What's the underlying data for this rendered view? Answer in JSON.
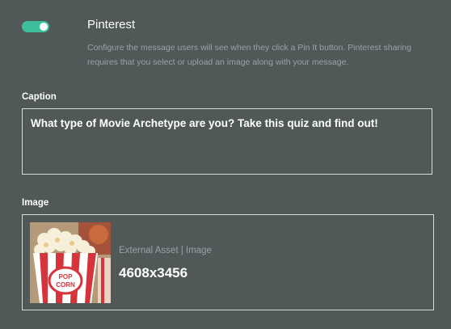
{
  "pinterest": {
    "enabled": true,
    "title": "Pinterest",
    "description": "Configure the message users will see when they click a Pin It button. Pinterest sharing requires that you select or upload an image along with your message."
  },
  "caption": {
    "label": "Caption",
    "value": "What type of Movie Archetype are you? Take this quiz and find out!"
  },
  "image": {
    "label": "Image",
    "asset_type": "External Asset | Image",
    "dimensions": "4608x3456",
    "thumbnail_text": "POP CORN"
  },
  "colors": {
    "background": "#505858",
    "toggle_on": "#3dbf9e",
    "muted_text": "#9aa3a3"
  }
}
